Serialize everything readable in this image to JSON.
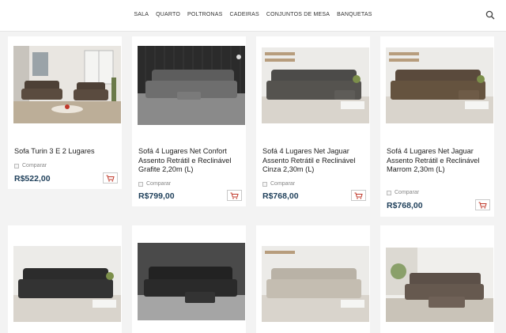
{
  "nav": {
    "items": [
      "SALA",
      "QUARTO",
      "POLTRONAS",
      "CADEIRAS",
      "CONJUNTOS DE MESA",
      "BANQUETAS"
    ]
  },
  "header": {
    "search_icon": "search-icon"
  },
  "products": [
    {
      "title": "Sofa Turin 3 E 2 Lugares",
      "compare": "Comparar",
      "price": "R$522,00"
    },
    {
      "title": "Sofá 4 Lugares Net Confort Assento Retrátil e Reclinável Grafite 2,20m (L)",
      "compare": "Comparar",
      "price": "R$799,00"
    },
    {
      "title": "Sofá 4 Lugares Net Jaguar Assento Retrátil e Reclinável Cinza 2,30m (L)",
      "compare": "Comparar",
      "price": "R$768,00"
    },
    {
      "title": "Sofá 4 Lugares Net Jaguar Assento Retrátil e Reclinável Marrom 2,30m (L)",
      "compare": "Comparar",
      "price": "R$768,00"
    }
  ],
  "colors": {
    "price": "#1e3f5a",
    "cart_accent": "#c0392b",
    "page_bg": "#f3f3f3"
  }
}
